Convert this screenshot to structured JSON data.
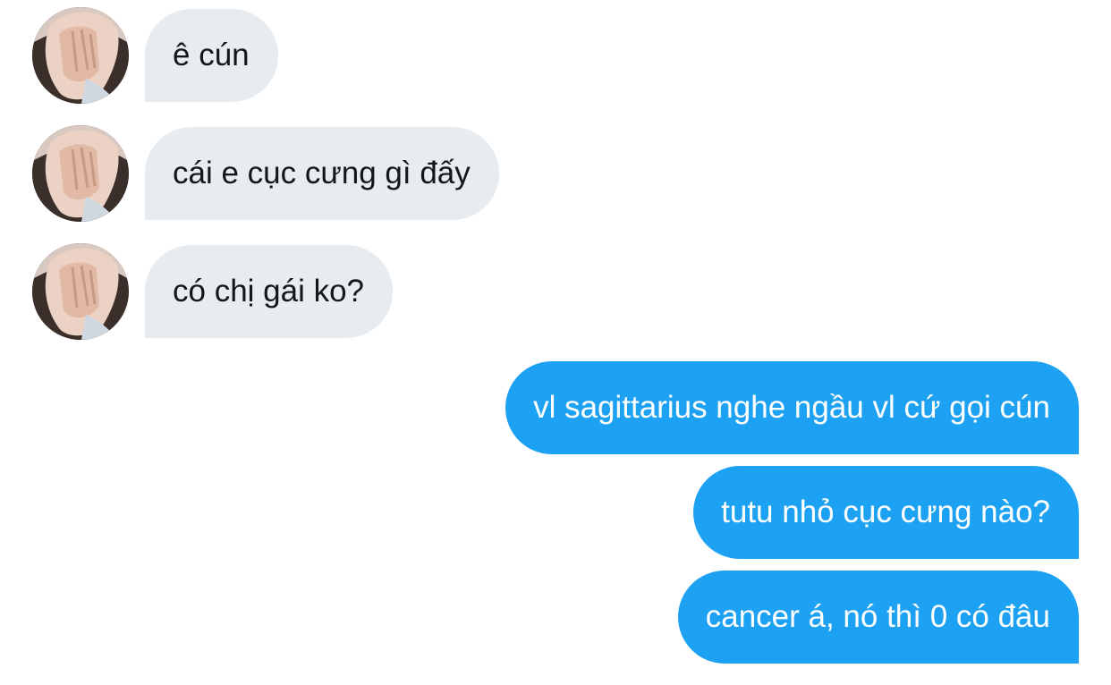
{
  "conversation": {
    "incoming": [
      {
        "text": "ê cún"
      },
      {
        "text": "cái e cục cưng gì đấy"
      },
      {
        "text": "có chị gái ko?"
      }
    ],
    "outgoing": [
      {
        "text": "vl sagittarius nghe ngầu vl cứ gọi cún"
      },
      {
        "text": "tutu nhỏ cục cưng nào?"
      },
      {
        "text": "cancer á, nó thì 0 có đâu"
      }
    ]
  },
  "colors": {
    "incoming_bubble": "#e6ecf0",
    "outgoing_bubble": "#1da1f2",
    "incoming_text": "#14171a",
    "outgoing_text": "#ffffff"
  },
  "icons": {
    "avatar": "user-avatar-photo"
  }
}
